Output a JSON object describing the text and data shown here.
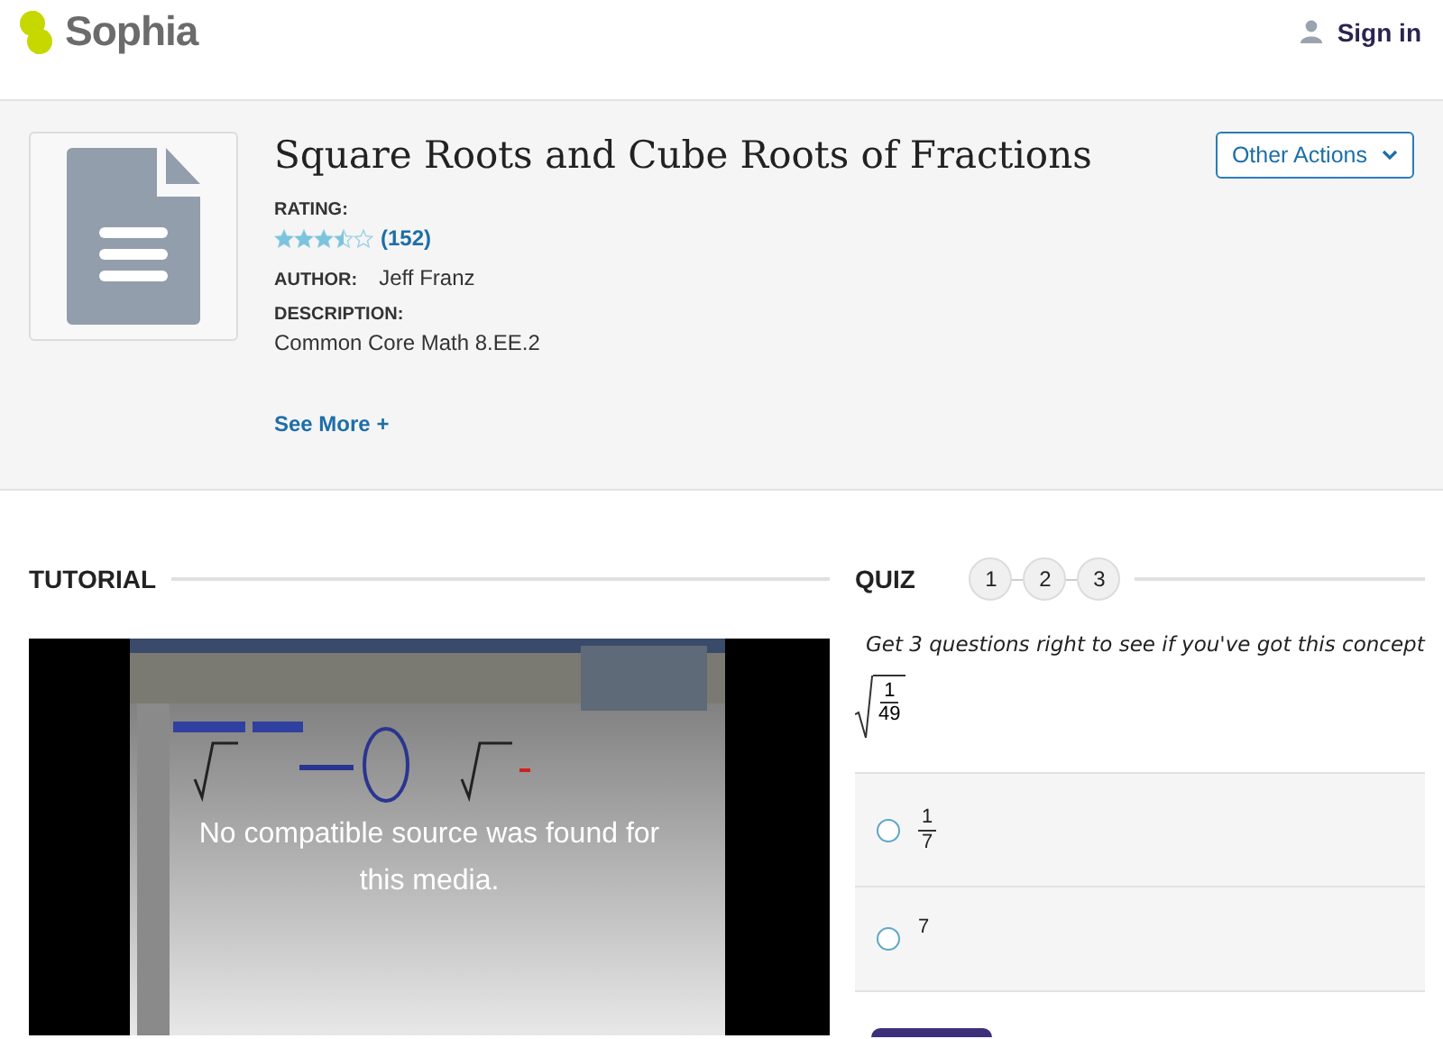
{
  "header": {
    "logo": "Sophia",
    "sign_in": "Sign in"
  },
  "resource": {
    "title": "Square Roots and Cube Roots of Fractions",
    "actions_button": "Other Actions",
    "rating_label": "RATING:",
    "stars": 3.5,
    "rating_count": "(152)",
    "author_label": "AUTHOR:",
    "author": "Jeff Franz",
    "description_label": "DESCRIPTION:",
    "description": "Common Core Math 8.EE.2",
    "see_more": "See More +"
  },
  "tutorial": {
    "heading": "TUTORIAL",
    "video": {
      "kind": "picture",
      "message": "No compatible source was found for this media."
    }
  },
  "quiz": {
    "heading": "QUIZ",
    "steps": [
      {
        "label": "1",
        "selected": false
      },
      {
        "label": "2",
        "selected": false
      },
      {
        "label": "3",
        "selected": false
      }
    ],
    "instruction": "Get 3 questions right to see if you've got this concept",
    "question": {
      "kind": "sqrt_fraction",
      "numerator": "1",
      "denominator": "49"
    },
    "options": [
      {
        "kind": "fraction",
        "numerator": "1",
        "denominator": "7",
        "selected": false
      },
      {
        "kind": "text",
        "text": "7",
        "selected": false
      }
    ]
  }
}
